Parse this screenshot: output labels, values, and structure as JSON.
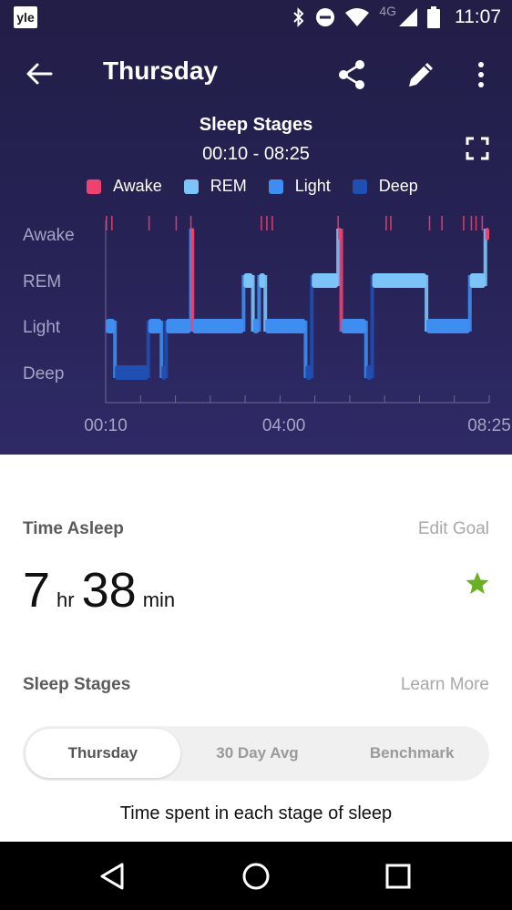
{
  "status_bar": {
    "app_badge": "yle",
    "network": "4G",
    "time": "11:07"
  },
  "header": {
    "title": "Thursday"
  },
  "chart_data": {
    "type": "line",
    "title": "Sleep Stages",
    "subtitle": "00:10 - 08:25",
    "stages": [
      "Awake",
      "REM",
      "Light",
      "Deep"
    ],
    "legend": [
      {
        "name": "Awake",
        "color": "#f0416f"
      },
      {
        "name": "REM",
        "color": "#7cc4f7"
      },
      {
        "name": "Light",
        "color": "#3d8ef0"
      },
      {
        "name": "Deep",
        "color": "#1f4fb0"
      }
    ],
    "x_ticks": [
      "00:10",
      "04:00",
      "08:25"
    ],
    "x_range_minutes": [
      0,
      495
    ],
    "segments": [
      {
        "stage": "Light",
        "start": 0,
        "end": 12
      },
      {
        "stage": "Deep",
        "start": 12,
        "end": 55
      },
      {
        "stage": "Light",
        "start": 55,
        "end": 72
      },
      {
        "stage": "Deep",
        "start": 72,
        "end": 78
      },
      {
        "stage": "Light",
        "start": 78,
        "end": 110
      },
      {
        "stage": "Awake",
        "start": 110,
        "end": 112
      },
      {
        "stage": "Light",
        "start": 112,
        "end": 178
      },
      {
        "stage": "REM",
        "start": 178,
        "end": 190
      },
      {
        "stage": "Light",
        "start": 190,
        "end": 198
      },
      {
        "stage": "REM",
        "start": 198,
        "end": 206
      },
      {
        "stage": "Light",
        "start": 206,
        "end": 258
      },
      {
        "stage": "Deep",
        "start": 258,
        "end": 266
      },
      {
        "stage": "REM",
        "start": 266,
        "end": 300
      },
      {
        "stage": "Awake",
        "start": 300,
        "end": 304
      },
      {
        "stage": "Light",
        "start": 304,
        "end": 336
      },
      {
        "stage": "Deep",
        "start": 336,
        "end": 344
      },
      {
        "stage": "REM",
        "start": 344,
        "end": 414
      },
      {
        "stage": "Light",
        "start": 414,
        "end": 470
      },
      {
        "stage": "REM",
        "start": 470,
        "end": 490
      },
      {
        "stage": "Awake",
        "start": 490,
        "end": 495
      }
    ],
    "awake_ticks": [
      1,
      8,
      56,
      91,
      110,
      201,
      208,
      215,
      300,
      362,
      368,
      418,
      434,
      462,
      472,
      478,
      486
    ]
  },
  "time_asleep": {
    "label": "Time Asleep",
    "action": "Edit Goal",
    "hours": "7",
    "hours_unit": "hr",
    "minutes": "38",
    "minutes_unit": "min"
  },
  "sleep_stages_section": {
    "label": "Sleep Stages",
    "action": "Learn More",
    "tabs": [
      {
        "label": "Thursday",
        "active": true
      },
      {
        "label": "30 Day Avg",
        "active": false
      },
      {
        "label": "Benchmark",
        "active": false
      }
    ],
    "subheading": "Time spent in each stage of sleep"
  },
  "colors": {
    "header_bg": "#252152",
    "goal_star": "#6ab023"
  }
}
